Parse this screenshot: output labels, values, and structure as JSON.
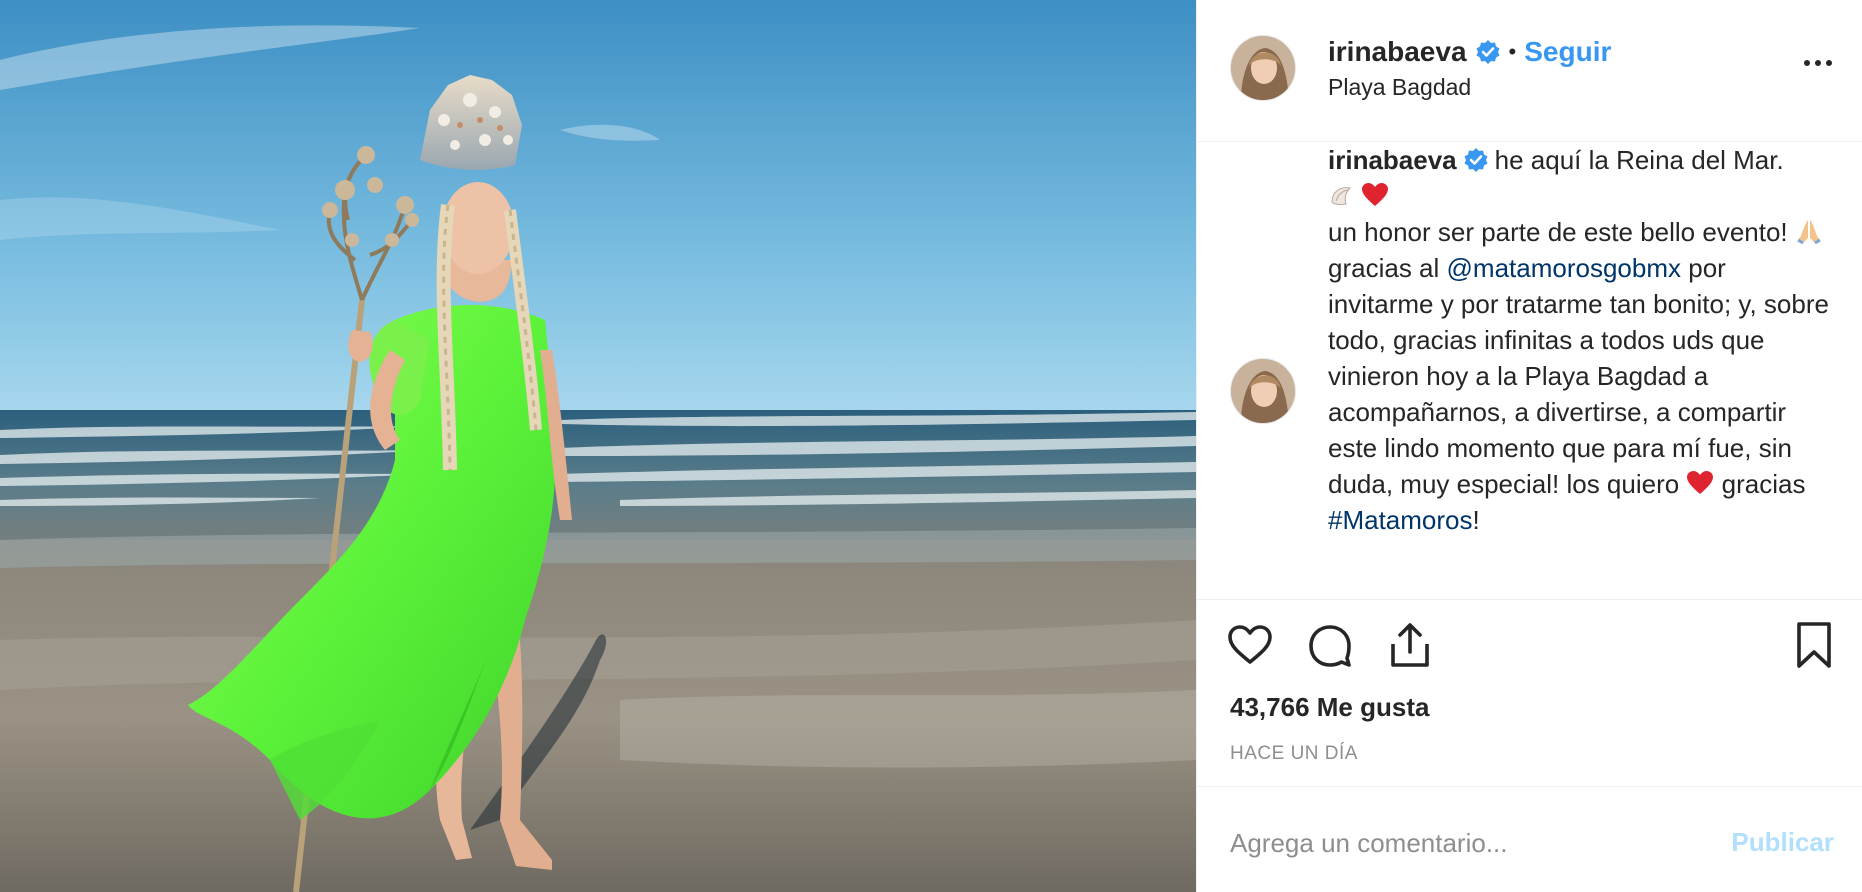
{
  "post": {
    "username": "irinabaeva",
    "follow_label": "Seguir",
    "separator": "•",
    "location": "Playa Bagdad",
    "image_subject": "beach-queen-photo"
  },
  "caption": {
    "username": "irinabaeva",
    "text_1": "he aquí la Reina del Mar.",
    "emoji_1": "shell-icon",
    "emoji_2": "heart-emoji",
    "text_2": "un honor ser parte de este bello evento!",
    "emoji_3": "pray-emoji",
    "text_3": "gracias al",
    "mention": "@matamorosgobmx",
    "text_4": "por invitarme y por tratarme tan bonito; y, sobre todo, gracias infinitas a todos uds que vinieron hoy a la Playa Bagdad a acompañarnos, a divertirse, a compartir este lindo momento que para mí fue, sin duda, muy especial! los quiero",
    "emoji_4": "heart-emoji",
    "text_5": "gracias",
    "hashtag": "#Matamoros",
    "text_6": "!"
  },
  "stats": {
    "likes_count": "43,766",
    "likes_label": "Me gusta",
    "time_ago": "HACE UN DÍA"
  },
  "comment": {
    "placeholder": "Agrega un comentario...",
    "publish_label": "Publicar"
  },
  "colors": {
    "link_blue": "#3897f0",
    "mention_blue": "#003569",
    "publish_disabled": "#b2dffc",
    "verified_blue": "#3897f0",
    "heart_red": "#e0242f"
  },
  "icons": [
    "verified-badge-icon",
    "more-options-icon",
    "like-heart-icon",
    "comment-icon",
    "share-icon",
    "save-bookmark-icon"
  ]
}
